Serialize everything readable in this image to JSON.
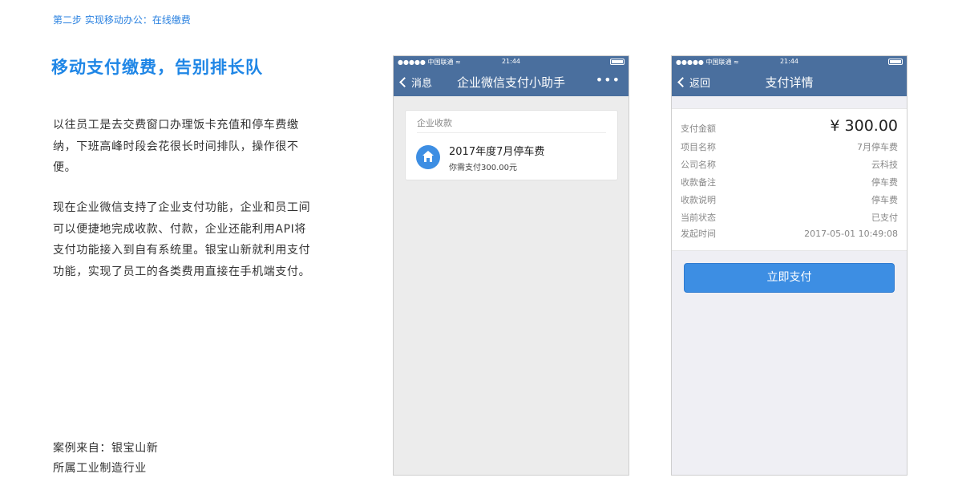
{
  "page": {
    "step": "第二步 实现移动办公：在线缴费",
    "headline": "移动支付缴费，告别排长队",
    "paragraph1": "以往员工是去交费窗口办理饭卡充值和停车费缴纳，下班高峰时段会花很长时间排队，操作很不便。",
    "paragraph2": "现在企业微信支持了企业支付功能，企业和员工间可以便捷地完成收款、付款，企业还能利用API将支付功能接入到自有系统里。银宝山新就利用支付功能，实现了员工的各类费用直接在手机端支付。",
    "source_line1": "案例来自：银宝山新",
    "source_line2": "所属工业制造行业"
  },
  "phone1": {
    "status": {
      "carrier": "●●●●● 中国联通 ≈",
      "time": "21:44"
    },
    "nav": {
      "back": "消息",
      "title": "企业微信支付小助手",
      "more": "•••"
    },
    "card": {
      "header": "企业收款",
      "icon": "home-icon",
      "title": "2017年度7月停车费",
      "subtitle": "你需支付300.00元"
    }
  },
  "phone2": {
    "status": {
      "carrier": "●●●●● 中国联通 ≈",
      "time": "21:44"
    },
    "nav": {
      "back": "返回",
      "title": "支付详情"
    },
    "details": {
      "amount_label": "支付金额",
      "amount_value": "¥ 300.00",
      "rows": [
        {
          "label": "项目名称",
          "value": "7月停车费"
        },
        {
          "label": "公司名称",
          "value": "云科技"
        },
        {
          "label": "收款备注",
          "value": "停车费"
        },
        {
          "label": "收款说明",
          "value": "停车费"
        },
        {
          "label": "当前状态",
          "value": "已支付"
        },
        {
          "label": "发起时间",
          "value": "2017-05-01  10:49:08"
        }
      ]
    },
    "button": "立即支付"
  },
  "colors": {
    "accent": "#1f86e6",
    "navbar": "#4a6f9e",
    "button": "#3d8ee3"
  }
}
